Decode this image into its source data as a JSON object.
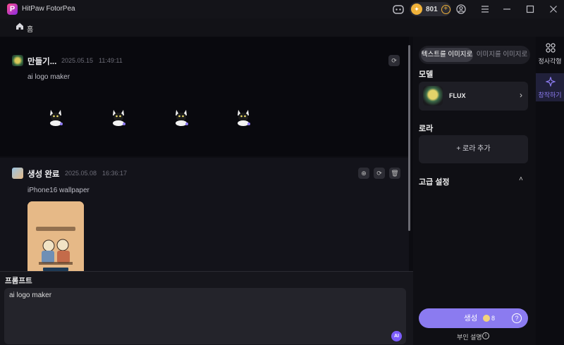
{
  "titlebar": {
    "app_name": "HitPaw FotorPea",
    "credits": "801",
    "coin_symbol": "✦",
    "controls": [
      "discord-icon",
      "add-credits-icon",
      "account-icon",
      "menu-icon",
      "minimize-icon",
      "maximize-icon",
      "close-icon"
    ]
  },
  "nav": {
    "home_label": "홈"
  },
  "feed": {
    "cards": [
      {
        "title": "만들기...",
        "date": "2025.05.15",
        "time": "11:49:11",
        "prompt": "ai logo maker",
        "image_count": 4
      },
      {
        "title": "생성 완료",
        "date": "2025.05.08",
        "time": "16:36:17",
        "prompt": "iPhone16 wallpaper"
      }
    ]
  },
  "prompt": {
    "label": "프롬프트",
    "value": "ai logo maker",
    "ai_badge": "AI"
  },
  "panel": {
    "tabs": [
      {
        "label": "텍스트를 이미지로",
        "active": true
      },
      {
        "label": "이미지를 이미지로",
        "active": false
      }
    ],
    "model_label": "모델",
    "model_name": "FLUX",
    "lora_label": "로라",
    "lora_add": "+ 로라 추가",
    "advanced_label": "고급 설정",
    "generate_label": "생성",
    "generate_cost": "8",
    "negative_label": "부인 설명"
  },
  "rail": {
    "items": [
      {
        "label": "정사각형",
        "active": false
      },
      {
        "label": "창작하기",
        "active": true
      }
    ]
  },
  "colors": {
    "accent": "#8b7bf0",
    "coin": "#f0b23a",
    "background": "#0c0c11",
    "panel": "#0f0f14"
  }
}
